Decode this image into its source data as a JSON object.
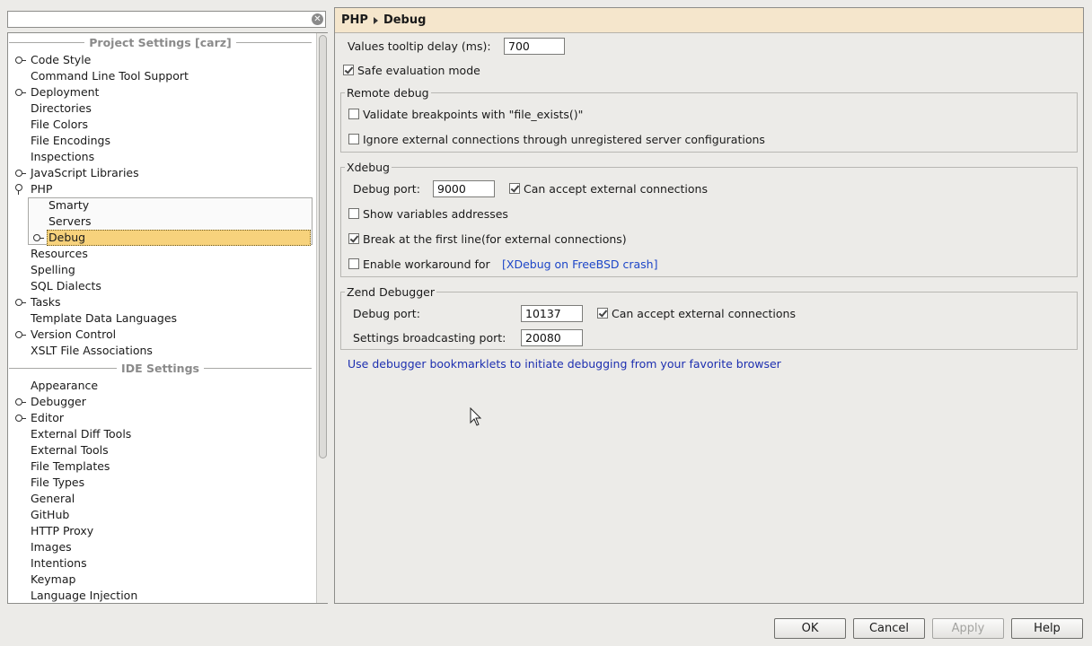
{
  "search": {
    "value": "",
    "clear_icon": "clear-icon"
  },
  "tree": {
    "project_header": "Project Settings [carz]",
    "ide_header": "IDE Settings",
    "project_items": [
      {
        "label": "Code Style",
        "expandable": true
      },
      {
        "label": "Command Line Tool Support",
        "expandable": false
      },
      {
        "label": "Deployment",
        "expandable": true
      },
      {
        "label": "Directories",
        "expandable": false
      },
      {
        "label": "File Colors",
        "expandable": false
      },
      {
        "label": "File Encodings",
        "expandable": false
      },
      {
        "label": "Inspections",
        "expandable": false
      },
      {
        "label": "JavaScript Libraries",
        "expandable": true
      },
      {
        "label": "PHP",
        "expandable": true,
        "expanded": true
      },
      {
        "label": "Smarty",
        "child": true
      },
      {
        "label": "Servers",
        "child": true
      },
      {
        "label": "Debug",
        "child": true,
        "expandable": true,
        "selected": true
      },
      {
        "label": "Resources",
        "expandable": false
      },
      {
        "label": "Spelling",
        "expandable": false
      },
      {
        "label": "SQL Dialects",
        "expandable": false
      },
      {
        "label": "Tasks",
        "expandable": true
      },
      {
        "label": "Template Data Languages",
        "expandable": false
      },
      {
        "label": "Version Control",
        "expandable": true
      },
      {
        "label": "XSLT File Associations",
        "expandable": false
      }
    ],
    "ide_items": [
      {
        "label": "Appearance",
        "expandable": false
      },
      {
        "label": "Debugger",
        "expandable": true
      },
      {
        "label": "Editor",
        "expandable": true
      },
      {
        "label": "External Diff Tools",
        "expandable": false
      },
      {
        "label": "External Tools",
        "expandable": false
      },
      {
        "label": "File Templates",
        "expandable": false
      },
      {
        "label": "File Types",
        "expandable": false
      },
      {
        "label": "General",
        "expandable": false
      },
      {
        "label": "GitHub",
        "expandable": false
      },
      {
        "label": "HTTP Proxy",
        "expandable": false
      },
      {
        "label": "Images",
        "expandable": false
      },
      {
        "label": "Intentions",
        "expandable": false
      },
      {
        "label": "Keymap",
        "expandable": false
      },
      {
        "label": "Language Injection",
        "expandable": false
      }
    ]
  },
  "breadcrumb": {
    "parent": "PHP",
    "current": "Debug"
  },
  "general": {
    "tooltip_delay_label": "Values tooltip delay (ms):",
    "tooltip_delay_value": "700",
    "safe_eval_label": "Safe evaluation mode",
    "safe_eval_checked": true
  },
  "remote_debug": {
    "title": "Remote debug",
    "validate_label": "Validate breakpoints with \"file_exists()\"",
    "validate_checked": false,
    "ignore_label": "Ignore external connections through unregistered server configurations",
    "ignore_checked": false
  },
  "xdebug": {
    "title": "Xdebug",
    "port_label": "Debug port:",
    "port_value": "9000",
    "accept_label": "Can accept external connections",
    "accept_checked": true,
    "show_vars_label": "Show variables addresses",
    "show_vars_checked": false,
    "break_label": "Break at the first line(for external connections)",
    "break_checked": true,
    "workaround_label": "Enable workaround for",
    "workaround_link": "[XDebug on FreeBSD crash]",
    "workaround_checked": false
  },
  "zend": {
    "title": "Zend Debugger",
    "port_label": "Debug port:",
    "port_value": "10137",
    "accept_label": "Can accept external connections",
    "accept_checked": true,
    "broadcast_label": "Settings broadcasting port:",
    "broadcast_value": "20080"
  },
  "bookmarklets_link": "Use debugger bookmarklets to initiate debugging from your favorite browser",
  "buttons": {
    "ok": "OK",
    "cancel": "Cancel",
    "apply": "Apply",
    "help": "Help"
  },
  "colors": {
    "selection": "#f7d27c",
    "breadcrumb_bg": "#f5e6cc",
    "link": "#1d46c8"
  }
}
